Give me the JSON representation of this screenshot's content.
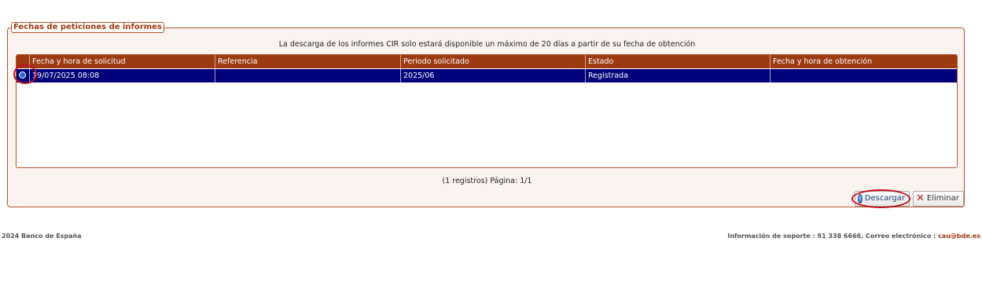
{
  "panel": {
    "legend": "Fechas de peticiones de informes",
    "notice": "La descarga de los informes CIR solo estará disponible un máximo de 20 días a partir de su fecha de obtención"
  },
  "table": {
    "columns": [
      "Fecha y hora de solicitud",
      "Referencia",
      "Periodo solicitado",
      "Estado",
      "Fecha y hora de obtención"
    ],
    "rows": [
      {
        "selected": true,
        "fecha_solicitud": "19/07/2025 08:08",
        "referencia": "",
        "periodo": "2025/06",
        "estado": "Registrada",
        "fecha_obtencion": ""
      }
    ]
  },
  "pager": {
    "text": "(1 registros) Página: 1/1"
  },
  "actions": {
    "download_label": "Descargar",
    "delete_label": "Eliminar"
  },
  "footer": {
    "copyright": "2024 Banco de España",
    "support_prefix": "Información de soporte : 91 338 6666, Correo electrónico : ",
    "email": "cau@bde.es"
  },
  "colors": {
    "header": "#9c3a12",
    "selected_row": "#00007b",
    "annotation_ring": "#c0101a"
  }
}
